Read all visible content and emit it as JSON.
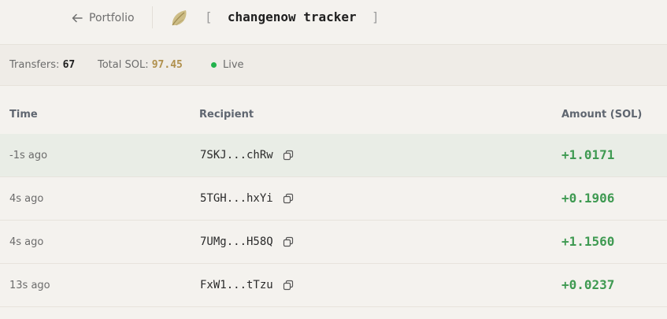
{
  "header": {
    "back_label": "Portfolio",
    "title": "changenow tracker",
    "bracket_open": "[",
    "bracket_close": "]"
  },
  "stats": {
    "transfers_label": "Transfers: ",
    "transfers_value": "67",
    "total_label": "Total SOL: ",
    "total_value": "97.45",
    "live_label": "Live"
  },
  "table": {
    "columns": [
      "Time",
      "Recipient",
      "Amount (SOL)"
    ],
    "rows": [
      {
        "time": "-1s ago",
        "recipient": "7SKJ...chRw",
        "amount": "+1.0171"
      },
      {
        "time": "4s ago",
        "recipient": "5TGH...hxYi",
        "amount": "+0.1906"
      },
      {
        "time": "4s ago",
        "recipient": "7UMg...H58Q",
        "amount": "+1.1560"
      },
      {
        "time": "13s ago",
        "recipient": "FxW1...tTzu",
        "amount": "+0.0237"
      }
    ]
  },
  "colors": {
    "accent_gold": "#b0904d",
    "positive_green": "#3f9a52",
    "live_dot": "#22b24c",
    "highlight_row": "#e9ede6"
  },
  "icons": {
    "back": "arrow-left-icon",
    "logo": "leaf-logo",
    "copy": "copy-icon"
  }
}
